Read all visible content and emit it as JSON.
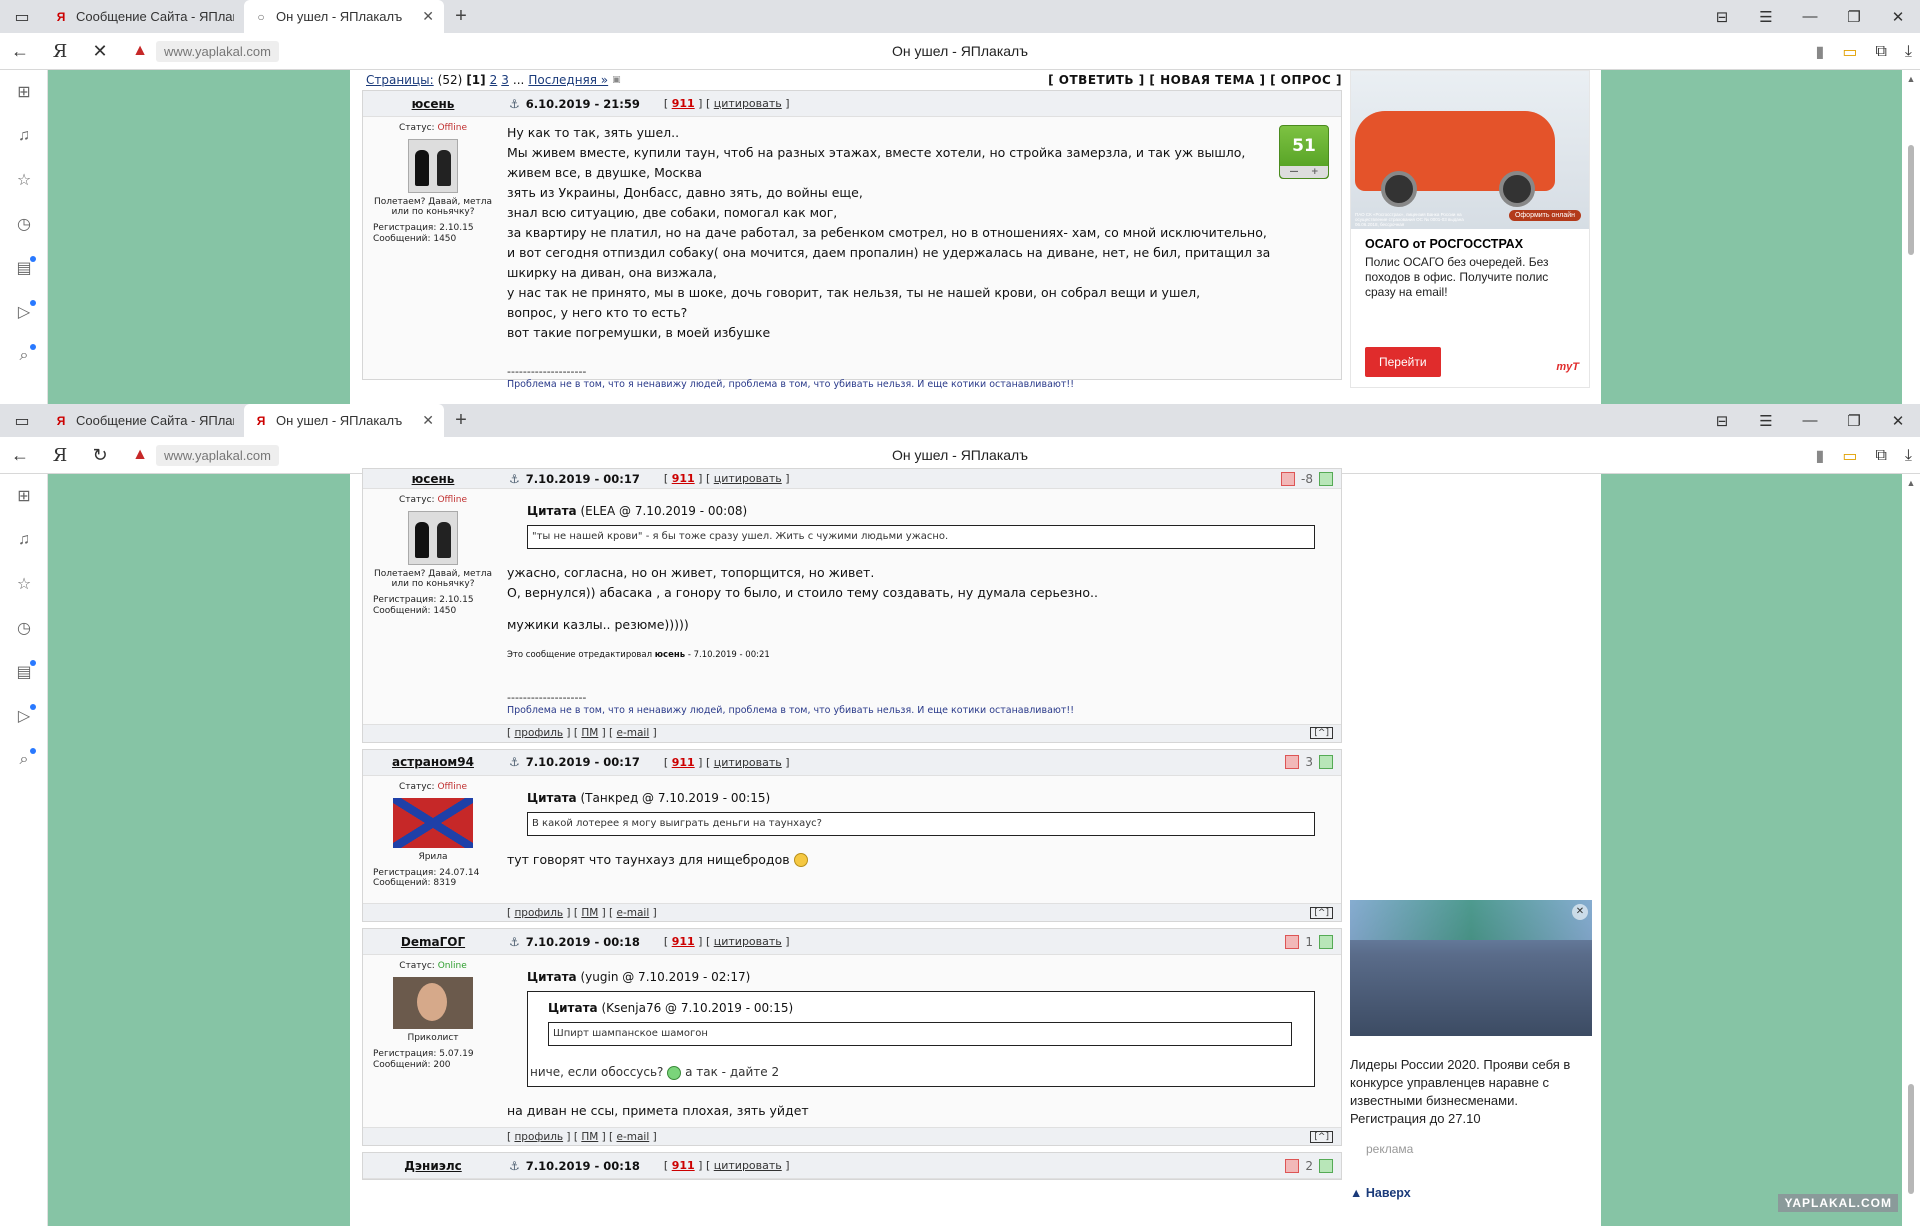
{
  "browser": {
    "tabs": [
      {
        "title": "Сообщение Сайта - ЯПлак"
      },
      {
        "title": "Он ушел - ЯПлакалъ"
      }
    ],
    "url": "www.yaplakal.com",
    "page_title": "Он ушел - ЯПлакалъ",
    "ya_glyph": "Я"
  },
  "pager": {
    "label": "Страницы:",
    "count": "(52)",
    "current": "[1]",
    "p2": "2",
    "p3": "3",
    "dots": "...",
    "last": "Последняя »",
    "actions": "[ ОТВЕТИТЬ ] [ НОВАЯ ТЕМА ] [ ОПРОС ]"
  },
  "links": {
    "n911": "911",
    "quote": "цитировать",
    "profile": "профиль",
    "pm": "ПМ",
    "email": "e-mail",
    "up": "[^]"
  },
  "post1": {
    "author": "юсень",
    "date": "6.10.2019 - 21:59",
    "status_label": "Статус:",
    "status": "Offline",
    "caption": "Полетаем? Давай, метла или по коньячку?",
    "reg": "Регистрация: 2.10.15",
    "msgs": "Сообщений: 1450",
    "score": "51",
    "lines": [
      "Ну как то так, зять ушел..",
      "Мы живем вместе, купили таун, чтоб на разных этажах, вместе хотели, но стройка замерзла, и так уж вышло,",
      "живем все, в двушке, Москва",
      "зять из Украины, Донбасс, давно зять, до войны еще,",
      "знал всю ситуацию, две собаки, помогал как мог,",
      "за квартиру не платил, но на даче работал, за ребенком смотрел, но в отношениях- хам, со мной исключительно,",
      "и вот сегодня отпиздил собаку( она мочится, даем пропалин) не удержалась на диване, нет, не бил, притащил за",
      "шкирку на диван, она визжала,",
      "у нас так не принято, мы в шоке, дочь говорит, так нельзя, ты не нашей крови, он собрал вещи и ушел,",
      "вопрос, у него кто то есть?",
      "вот такие погремушки, в моей избушке"
    ],
    "sig_line": "--------------------",
    "sig": "Проблема не в том, что я ненавижу людей, проблема в том, что убивать нельзя. И еще котики останавливают!!"
  },
  "post2": {
    "author": "юсень",
    "date": "7.10.2019 - 00:17",
    "rating": "-8",
    "status_label": "Статус:",
    "status": "Offline",
    "caption": "Полетаем? Давай, метла или по коньячку?",
    "reg": "Регистрация: 2.10.15",
    "msgs": "Сообщений: 1450",
    "quote_head": "Цитата",
    "quote_src": "(ELEA @ 7.10.2019 - 00:08)",
    "quote_text": "\"ты не нашей крови\" - я бы тоже сразу ушел. Жить с чужими людьми ужасно.",
    "line1": "ужасно, согласна, но он живет, топорщится, но живет.",
    "line2": "О, вернулся)) абасака , а гонору то было, и стоило тему создавать, ну думала серьезно..",
    "line3": "мужики казлы.. резюме)))))",
    "edited_pre": "Это сообщение отредактировал",
    "edited_by": "юсень",
    "edited_post": "- 7.10.2019 - 00:21",
    "sig_line": "--------------------",
    "sig": "Проблема не в том, что я ненавижу людей, проблема в том, что убивать нельзя. И еще котики останавливают!!"
  },
  "post3": {
    "author": "астраном94",
    "date": "7.10.2019 - 00:17",
    "rating": "3",
    "status_label": "Статус:",
    "status": "Offline",
    "caption": "Ярила",
    "reg": "Регистрация: 24.07.14",
    "msgs": "Сообщений: 8319",
    "quote_head": "Цитата",
    "quote_src": "(Танкред @ 7.10.2019 - 00:15)",
    "quote_text": "В какой лотерее я могу выиграть деньги на таунхаус?",
    "line1": "тут говорят что таунхауз для нищебродов"
  },
  "post4": {
    "author": "DemaГОГ",
    "date": "7.10.2019 - 00:18",
    "rating": "1",
    "status_label": "Статус:",
    "status": "Online",
    "caption": "Приколист",
    "reg": "Регистрация: 5.07.19",
    "msgs": "Сообщений: 200",
    "quote_head": "Цитата",
    "quote_src": "(yugin @ 7.10.2019 - 02:17)",
    "inner_head": "Цитата",
    "inner_src": "(Ksenja76 @ 7.10.2019 - 00:15)",
    "inner_text": "Шпирт шампанское шамогон",
    "quote_tail_a": "ниче, если обоссусь?",
    "quote_tail_b": "а так - дайте 2",
    "line1": "на диван не ссы, примета плохая, зять уйдет"
  },
  "post5": {
    "author": "Дэниэлс",
    "date": "7.10.2019 - 00:18",
    "rating": "2"
  },
  "ad1": {
    "title": "ОСАГО от РОСГОССТРАХ",
    "desc": "Полис ОСАГО без очередей. Без походов в офис. Получите полис сразу на email!",
    "button": "Перейти",
    "cta": "Оформить онлайн",
    "logo": "myT",
    "fine": "ПАО СК «Росгосстрах», лицензия Банка России на осуществление страхования ОС № 0001-03 выдана 06.06.2018, бессрочная"
  },
  "ad2": {
    "text": "Лидеры России 2020. Прояви себя в конкурсе управленцев наравне с известными бизнесменами. Регистрация до 27.10",
    "label": "реклама",
    "up": "▲ Наверх"
  },
  "watermark": "YAPLAKAL.COM",
  "colors": {
    "bg_green": "#86c4a5",
    "accent_red": "#c00000",
    "score_green": "#5aa829"
  }
}
